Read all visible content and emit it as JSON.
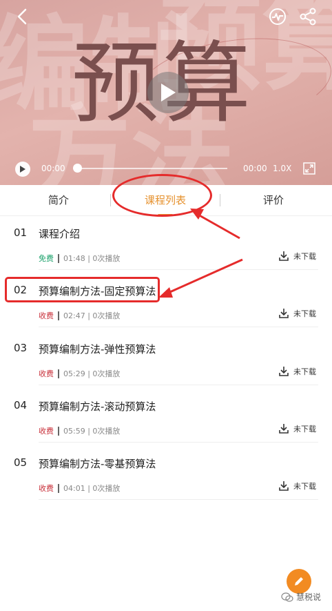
{
  "video": {
    "big_title": "预算",
    "current_time": "00:00",
    "total_time": "00:00",
    "speed": "1.0X"
  },
  "tabs": [
    {
      "label": "简介"
    },
    {
      "label": "课程列表"
    },
    {
      "label": "评价"
    }
  ],
  "lessons": [
    {
      "num": "01",
      "title": "课程介绍",
      "price": "免费",
      "price_color": "#1aa06a",
      "meta": "01:48 | 0次播放",
      "download": "未下载"
    },
    {
      "num": "02",
      "title": "预算编制方法-固定预算法",
      "price": "收费",
      "price_color": "#c8303a",
      "meta": "02:47 | 0次播放",
      "download": "未下载"
    },
    {
      "num": "03",
      "title": "预算编制方法-弹性预算法",
      "price": "收费",
      "price_color": "#c8303a",
      "meta": "05:29 | 0次播放",
      "download": "未下载"
    },
    {
      "num": "04",
      "title": "预算编制方法-滚动预算法",
      "price": "收费",
      "price_color": "#c8303a",
      "meta": "05:59 | 0次播放",
      "download": "未下载"
    },
    {
      "num": "05",
      "title": "预算编制方法-零基预算法",
      "price": "收费",
      "price_color": "#c8303a",
      "meta": "04:01 | 0次播放",
      "download": "未下载"
    }
  ],
  "watermark": "慧税说",
  "colors": {
    "accent": "#e6922f",
    "annotation": "#e52b2b",
    "fab": "#f28b22"
  }
}
